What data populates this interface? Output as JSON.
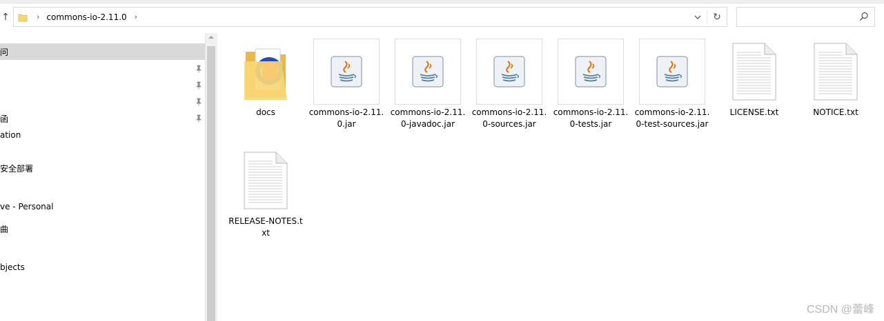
{
  "address_bar": {
    "crumb": "commons-io-2.11.0",
    "separator": "›",
    "dropdown_glyph": "⌄",
    "refresh_glyph": "↻",
    "up_glyph": "↑"
  },
  "search": {
    "placeholder": ""
  },
  "nav": {
    "items": [
      {
        "label": "问",
        "selected": true,
        "pinned": false
      },
      {
        "label": "",
        "selected": false,
        "pinned": true
      },
      {
        "label": "",
        "selected": false,
        "pinned": true
      },
      {
        "label": "",
        "selected": false,
        "pinned": true
      },
      {
        "label": "函",
        "selected": false,
        "pinned": true
      },
      {
        "label": "ation",
        "selected": false,
        "pinned": false
      },
      {
        "label": "安全部署",
        "selected": false,
        "pinned": false
      },
      {
        "label": "ve - Personal",
        "selected": false,
        "pinned": false
      },
      {
        "label": "曲",
        "selected": false,
        "pinned": false
      },
      {
        "label": "bjects",
        "selected": false,
        "pinned": false
      }
    ]
  },
  "files": [
    {
      "name": "docs",
      "type": "folder"
    },
    {
      "name": "commons-io-2.11.0.jar",
      "type": "jar"
    },
    {
      "name": "commons-io-2.11.0-javadoc.jar",
      "type": "jar"
    },
    {
      "name": "commons-io-2.11.0-sources.jar",
      "type": "jar"
    },
    {
      "name": "commons-io-2.11.0-tests.jar",
      "type": "jar"
    },
    {
      "name": "commons-io-2.11.0-test-sources.jar",
      "type": "jar"
    },
    {
      "name": "LICENSE.txt",
      "type": "txt"
    },
    {
      "name": "NOTICE.txt",
      "type": "txt"
    },
    {
      "name": "RELEASE-NOTES.txt",
      "type": "txt"
    }
  ],
  "watermark": "CSDN @蕾峰",
  "colors": {
    "selection": "#d9d9d9",
    "folder_yellow": "#f8d775",
    "java_orange": "#e76f00",
    "java_blue": "#5382a1"
  }
}
